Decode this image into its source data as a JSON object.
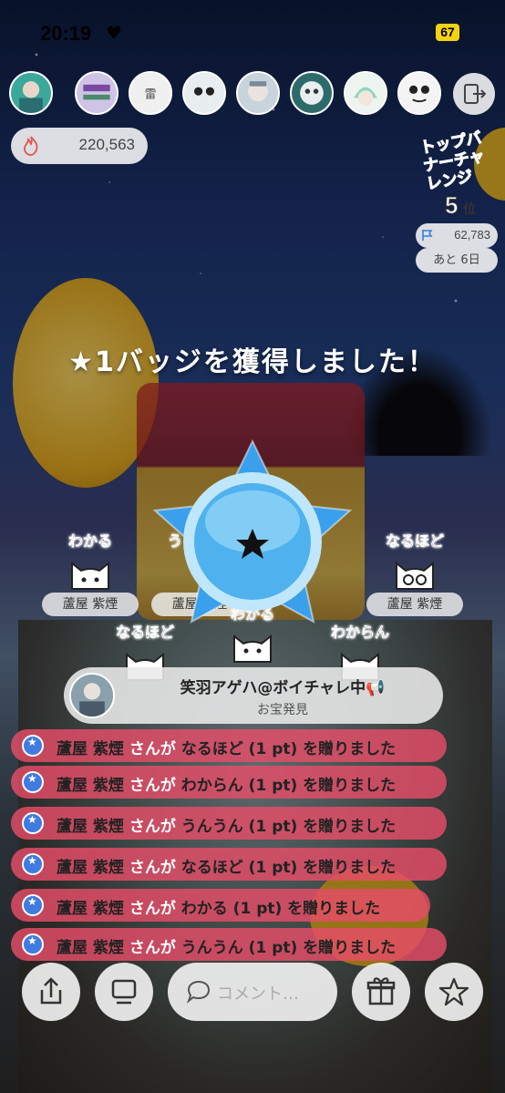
{
  "status_bar": {
    "time": "20:19",
    "heart": "♥",
    "battery": "67"
  },
  "points": {
    "value": "220,563",
    "icon": "fire-icon"
  },
  "event": {
    "logo_text": "トップバナーチャレンジ",
    "rank_number": "5",
    "rank_unit": "位",
    "score": "62,783",
    "remaining": "あと 6日"
  },
  "badge_message": "★1バッジを獲得しました！",
  "stamps": [
    {
      "word": "わかる",
      "name": "蘆屋 紫煙"
    },
    {
      "word": "う",
      "name": "蘆屋 紫煙"
    },
    {
      "word": "なるほど",
      "name": "蘆屋 紫煙"
    },
    {
      "word": "なるほど",
      "name": ""
    },
    {
      "word": "わかる",
      "name": ""
    },
    {
      "word": "わからん",
      "name": ""
    }
  ],
  "treasure_card": {
    "user": "笑羽アゲハ@ボイチャレ中📢",
    "event": "お宝発見"
  },
  "gift_log": [
    {
      "name": "蘆屋 紫煙",
      "mid": "さんが",
      "text": "なるほど (1 pt) を贈りました"
    },
    {
      "name": "蘆屋 紫煙",
      "mid": "さんが",
      "text": "わからん (1 pt) を贈りました"
    },
    {
      "name": "蘆屋 紫煙",
      "mid": "さんが",
      "text": "うんうん (1 pt) を贈りました"
    },
    {
      "name": "蘆屋 紫煙",
      "mid": "さんが",
      "text": "なるほど (1 pt) を贈りました"
    },
    {
      "name": "蘆屋 紫煙",
      "mid": "さんが",
      "text": "わかる (1 pt) を贈りました"
    },
    {
      "name": "蘆屋 紫煙",
      "mid": "さんが",
      "text": "うんうん (1 pt) を贈りました"
    }
  ],
  "bottom_bar": {
    "comment_placeholder": "コメント…"
  },
  "colors": {
    "accent_blue": "#3a9be8",
    "gift_row": "#e74d68",
    "battery": "#f2d312"
  }
}
